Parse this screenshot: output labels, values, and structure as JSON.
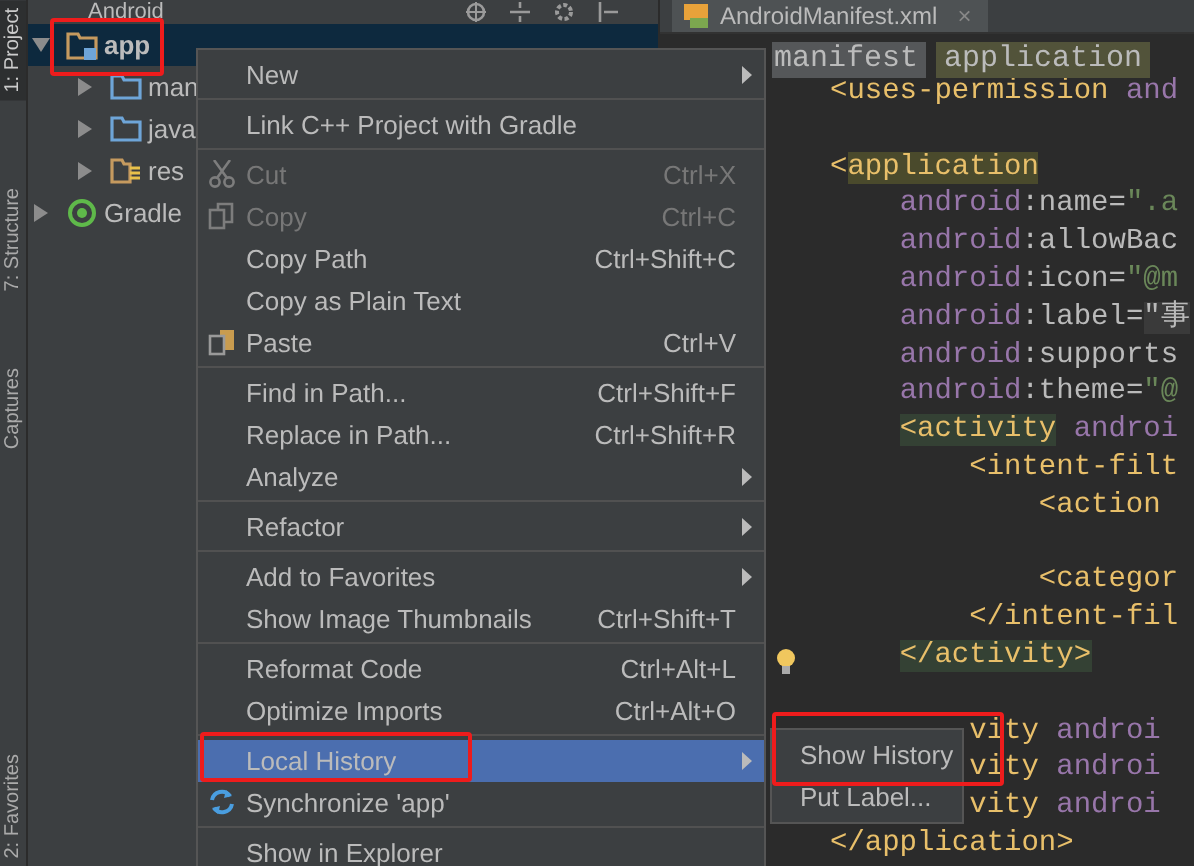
{
  "tool_strip": [
    {
      "label": "1: Project",
      "selected": true
    },
    {
      "label": "7: Structure",
      "selected": false
    },
    {
      "label": "Captures",
      "selected": false
    },
    {
      "label": "2: Favorites",
      "selected": false
    }
  ],
  "project_panel": {
    "title": "Android",
    "tree": [
      {
        "label": "app",
        "kind": "module",
        "expanded": true,
        "selected": true,
        "children": [
          {
            "label": "man",
            "kind": "folder",
            "expanded": false,
            "selected": false
          },
          {
            "label": "java",
            "kind": "folder",
            "expanded": false,
            "selected": false
          },
          {
            "label": "res",
            "kind": "resources",
            "expanded": false,
            "selected": false
          }
        ]
      },
      {
        "label": "Gradle",
        "kind": "gradle",
        "expanded": false,
        "selected": false
      }
    ]
  },
  "editor": {
    "tab": {
      "label": "AndroidManifest.xml",
      "close": "×"
    },
    "breadcrumbs": [
      {
        "label": "manifest",
        "selected": false
      },
      {
        "label": "application",
        "selected": true
      }
    ],
    "lines": [
      {
        "segments": [
          {
            "kind": "tag",
            "text": "<uses-permission"
          },
          {
            "kind": "ns",
            "text": " and"
          }
        ]
      },
      {
        "gap_before": true,
        "segments": [
          {
            "kind": "tag",
            "text": "<"
          },
          {
            "kind": "tag-hl",
            "text": "application"
          }
        ]
      },
      {
        "segments": [
          {
            "kind": "ns",
            "text": "    android"
          },
          {
            "kind": "attr",
            "text": ":name="
          },
          {
            "kind": "value",
            "text": "\".a"
          }
        ]
      },
      {
        "segments": [
          {
            "kind": "ns",
            "text": "    android"
          },
          {
            "kind": "attr",
            "text": ":allowBac"
          }
        ]
      },
      {
        "segments": [
          {
            "kind": "ns",
            "text": "    android"
          },
          {
            "kind": "attr",
            "text": ":icon="
          },
          {
            "kind": "value",
            "text": "\"@m"
          }
        ]
      },
      {
        "segments": [
          {
            "kind": "ns",
            "text": "    android"
          },
          {
            "kind": "attr",
            "text": ":label="
          },
          {
            "kind": "value-hl",
            "text": "\"事"
          }
        ]
      },
      {
        "segments": [
          {
            "kind": "ns",
            "text": "    android"
          },
          {
            "kind": "attr",
            "text": ":supports"
          }
        ]
      },
      {
        "segments": [
          {
            "kind": "ns",
            "text": "    android"
          },
          {
            "kind": "attr",
            "text": ":theme="
          },
          {
            "kind": "value",
            "text": "\"@"
          }
        ]
      },
      {
        "segments": [
          {
            "kind": "tag-green",
            "text": "    <activity"
          },
          {
            "kind": "ns",
            "text": " androi"
          }
        ]
      },
      {
        "segments": [
          {
            "kind": "tag",
            "text": "        <intent-filt"
          }
        ]
      },
      {
        "segments": [
          {
            "kind": "tag",
            "text": "            <action"
          }
        ]
      },
      {
        "gap_before": true,
        "segments": [
          {
            "kind": "tag",
            "text": "            <categor"
          }
        ]
      },
      {
        "segments": [
          {
            "kind": "tag",
            "text": "        </intent-fil"
          }
        ]
      },
      {
        "segments": [
          {
            "kind": "tag-green",
            "text": "    </activity>"
          }
        ]
      },
      {
        "gap_before": true,
        "segments": [
          {
            "kind": "tag",
            "text": "        vity"
          },
          {
            "kind": "ns",
            "text": " androi"
          }
        ]
      },
      {
        "segments": [
          {
            "kind": "tag",
            "text": "        vity"
          },
          {
            "kind": "ns",
            "text": " androi"
          }
        ]
      },
      {
        "segments": [
          {
            "kind": "tag",
            "text": "        vity"
          },
          {
            "kind": "ns",
            "text": " androi"
          }
        ]
      },
      {
        "segments": [
          {
            "kind": "tag",
            "text": "</application>"
          }
        ]
      }
    ]
  },
  "context_menu": {
    "groups": [
      [
        {
          "label": "New",
          "submenu": true,
          "disabled": false,
          "selected": false
        }
      ],
      [
        {
          "label": "Link C++ Project with Gradle",
          "submenu": false,
          "disabled": false,
          "selected": false
        }
      ],
      [
        {
          "label": "Cut",
          "shortcut": "Ctrl+X",
          "kind": "cut",
          "submenu": false,
          "disabled": true,
          "selected": false
        },
        {
          "label": "Copy",
          "shortcut": "Ctrl+C",
          "kind": "copy",
          "submenu": false,
          "disabled": true,
          "selected": false
        },
        {
          "label": "Copy Path",
          "shortcut": "Ctrl+Shift+C",
          "submenu": false,
          "disabled": false,
          "selected": false
        },
        {
          "label": "Copy as Plain Text",
          "submenu": false,
          "disabled": false,
          "selected": false
        },
        {
          "label": "Paste",
          "shortcut": "Ctrl+V",
          "kind": "paste",
          "submenu": false,
          "disabled": false,
          "selected": false
        }
      ],
      [
        {
          "label": "Find in Path...",
          "shortcut": "Ctrl+Shift+F",
          "submenu": false,
          "disabled": false,
          "selected": false
        },
        {
          "label": "Replace in Path...",
          "shortcut": "Ctrl+Shift+R",
          "submenu": false,
          "disabled": false,
          "selected": false
        },
        {
          "label": "Analyze",
          "submenu": true,
          "disabled": false,
          "selected": false
        }
      ],
      [
        {
          "label": "Refactor",
          "submenu": true,
          "disabled": false,
          "selected": false
        }
      ],
      [
        {
          "label": "Add to Favorites",
          "submenu": true,
          "disabled": false,
          "selected": false
        },
        {
          "label": "Show Image Thumbnails",
          "shortcut": "Ctrl+Shift+T",
          "submenu": false,
          "disabled": false,
          "selected": false
        }
      ],
      [
        {
          "label": "Reformat Code",
          "shortcut": "Ctrl+Alt+L",
          "submenu": false,
          "disabled": false,
          "selected": false
        },
        {
          "label": "Optimize Imports",
          "shortcut": "Ctrl+Alt+O",
          "submenu": false,
          "disabled": false,
          "selected": false
        }
      ],
      [
        {
          "label": "Local History",
          "submenu": true,
          "disabled": false,
          "selected": true
        },
        {
          "label": "Synchronize 'app'",
          "kind": "sync",
          "submenu": false,
          "disabled": false,
          "selected": false
        }
      ],
      [
        {
          "label": "Show in Explorer",
          "submenu": false,
          "disabled": false,
          "selected": false
        }
      ]
    ]
  },
  "submenu": {
    "items": [
      {
        "label": "Show History",
        "selected": false
      },
      {
        "label": "Put Label...",
        "selected": false
      }
    ]
  }
}
